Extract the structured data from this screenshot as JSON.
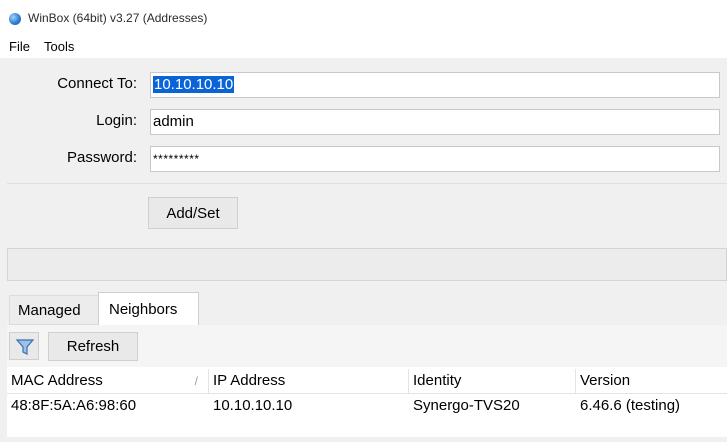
{
  "window": {
    "title": "WinBox (64bit) v3.27 (Addresses)"
  },
  "menu": {
    "items": [
      "File",
      "Tools"
    ]
  },
  "form": {
    "connect_to_label": "Connect To:",
    "connect_to_value": "10.10.10.10",
    "login_label": "Login:",
    "login_value": "admin",
    "password_label": "Password:",
    "password_value": "*********",
    "add_set_label": "Add/Set"
  },
  "tabs": {
    "items": [
      {
        "label": "Managed",
        "active": false
      },
      {
        "label": "Neighbors",
        "active": true
      }
    ]
  },
  "toolbar": {
    "filter_icon": "filter-icon",
    "refresh_label": "Refresh"
  },
  "table": {
    "columns": [
      "MAC Address",
      "IP Address",
      "Identity",
      "Version"
    ],
    "rows": [
      {
        "mac": "48:8F:5A:A6:98:60",
        "ip": "10.10.10.10",
        "identity": "Synergo-TVS20",
        "version": "6.46.6 (testing)"
      }
    ]
  },
  "colors": {
    "selection": "#0a64d8",
    "app_icon": "#2f7fd0",
    "filter_icon": "#3a6fb0"
  }
}
